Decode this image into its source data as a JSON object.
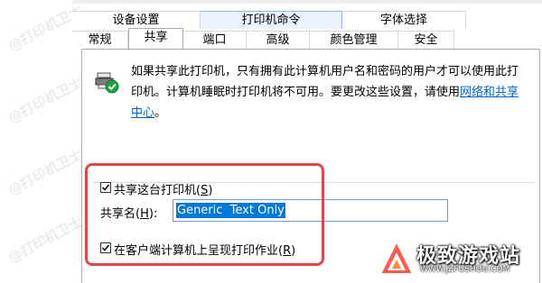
{
  "watermark_text": "@打印机卫士",
  "tabs_row1": [
    {
      "label": "设备设置"
    },
    {
      "label": "打印机命令"
    },
    {
      "label": "字体选择"
    }
  ],
  "tabs_row2": [
    {
      "label": "常规"
    },
    {
      "label": "共享"
    },
    {
      "label": "端口"
    },
    {
      "label": "高级"
    },
    {
      "label": "颜色管理"
    },
    {
      "label": "安全"
    }
  ],
  "active_tab": "共享",
  "sharing": {
    "info_text": "如果共享此打印机，只有拥有此计算机用户名和密码的用户才可以使用此打印机。计算机睡眠时打印机将不可用。要更改这些设置，请使用",
    "link_text": "网络和共享中心",
    "info_suffix": "。",
    "share_checkbox": {
      "label": "共享这台打印机",
      "accel": "S",
      "checked": true
    },
    "share_name_label": "共享名",
    "share_name_accel": "H",
    "share_name_value": "Generic  Text Only",
    "render_checkbox": {
      "label": "在客户端计算机上呈现打印作业",
      "accel": "R",
      "checked": true
    }
  },
  "brand": {
    "name": "极致游戏站",
    "url": "WWW.JZFUSHOU.COM"
  },
  "colors": {
    "highlight": "#e04848",
    "link": "#0066cc",
    "selection": "#0078d7"
  }
}
